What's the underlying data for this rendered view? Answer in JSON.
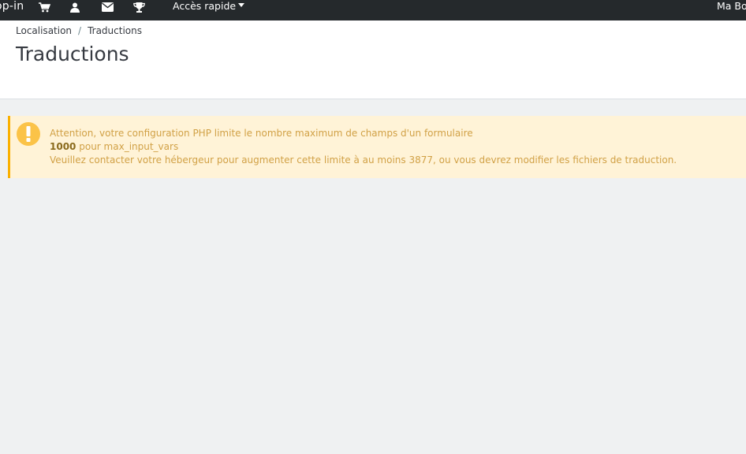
{
  "topbar": {
    "brand_text": "op-in",
    "icons": [
      "cart-icon",
      "user-icon",
      "envelope-icon",
      "trophy-icon"
    ],
    "quick_access_label": "Accès rapide",
    "shop_name": "Ma Bo"
  },
  "header": {
    "breadcrumb": [
      "Localisation",
      "Traductions"
    ],
    "breadcrumb_separator": "/",
    "title": "Traductions"
  },
  "alert": {
    "type": "warning",
    "line1": "Attention, votre configuration PHP limite le nombre maximum de champs d'un formulaire",
    "line2_value": "1000",
    "line2_text": "pour max_input_vars",
    "line3": "Veuillez contacter votre hébergeur pour augmenter cette limite à au moins 3877, ou vous devrez modifier les fichiers de traduction."
  },
  "colors": {
    "topbar": "#25292c",
    "background": "#eff1f2",
    "alert_bg": "#fff3d7",
    "alert_border": "#fab000",
    "alert_text": "#d1a146"
  }
}
